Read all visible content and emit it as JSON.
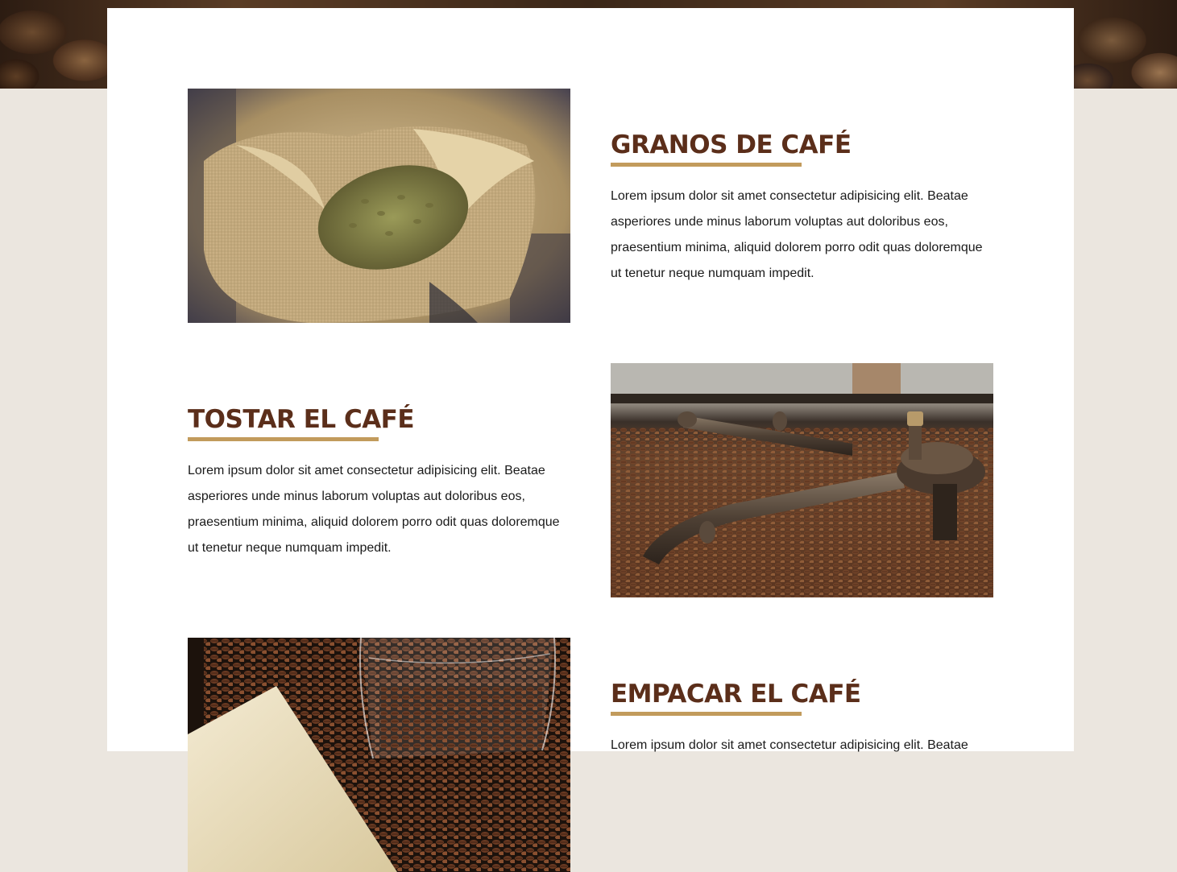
{
  "sections": [
    {
      "title": "GRANOS DE CAFÉ",
      "body": "Lorem ipsum dolor sit amet consectetur adipisicing elit. Beatae asperiores unde minus laborum voluptas aut doloribus eos, praesentium minima, aliquid dolorem porro odit quas doloremque ut tenetur neque numquam impedit.",
      "image": "coffee-sack-photo"
    },
    {
      "title": "TOSTAR EL CAFÉ",
      "body": "Lorem ipsum dolor sit amet consectetur adipisicing elit. Beatae asperiores unde minus laborum voluptas aut doloribus eos, praesentium minima, aliquid dolorem porro odit quas doloremque ut tenetur neque numquam impedit.",
      "image": "coffee-roaster-photo"
    },
    {
      "title": "EMPACAR EL CAFÉ",
      "body": "Lorem ipsum dolor sit amet consectetur adipisicing elit. Beatae",
      "image": "coffee-glass-photo"
    }
  ],
  "colors": {
    "page_background": "#ebe6df",
    "title": "#5b2e1a",
    "accent_underline": "#c29b5c",
    "body_text": "#1a1a1a"
  }
}
